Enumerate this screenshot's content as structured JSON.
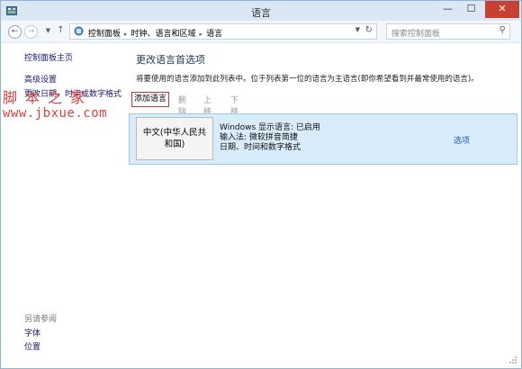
{
  "window": {
    "title": "语言",
    "minimize": "—",
    "maximize": "☐",
    "close": "✕"
  },
  "addressbar": {
    "back": "←",
    "forward": "→",
    "recent": "▼",
    "up": "↑",
    "breadcrumbs": [
      "控制面板",
      "时钟、语言和区域",
      "语言"
    ],
    "separator": "▸",
    "dropdown": "▼",
    "refresh": "↻",
    "search_placeholder": "搜索控制面板",
    "search_glyph": "⚲"
  },
  "sidebar": {
    "items": [
      "控制面板主页",
      "高级设置",
      "更改日期、时间或数字格式"
    ],
    "also_see_title": "另请参阅",
    "also_see_items": [
      "字体",
      "位置"
    ]
  },
  "watermark": {
    "line1": "脚本之家",
    "line2": "www.jbxue.com"
  },
  "main": {
    "title": "更改语言首选项",
    "description": "将要使用的语言添加到此列表中。位于列表第一位的语言为主语言(即你希望看到并最常使用的语言)。",
    "toolbar": {
      "add": "添加语言",
      "delete": "删除",
      "move_up": "上移",
      "move_down": "下移"
    },
    "languages": [
      {
        "name": "中文(中华人民共和国)",
        "display": "Windows 显示语言: 已启用",
        "input": "输入法: 微软拼音简捷",
        "format": "日期、时间和数字格式",
        "options": "选项"
      }
    ]
  }
}
